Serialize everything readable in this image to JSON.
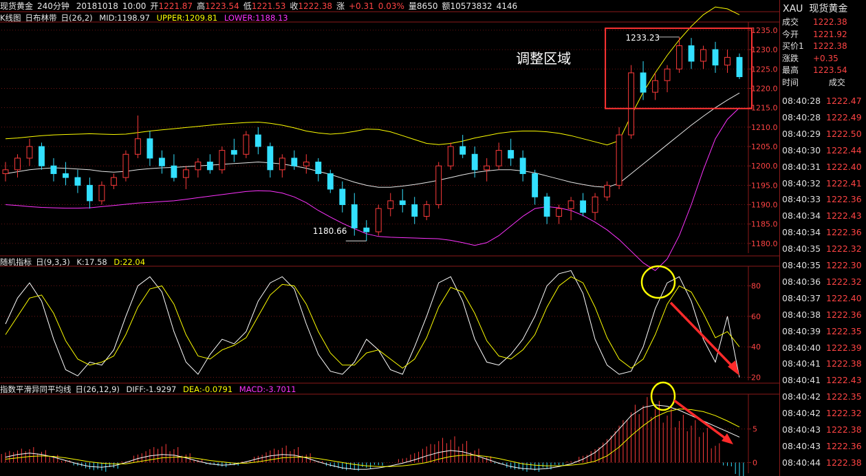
{
  "header": {
    "symbol": "现货黄金",
    "period": "240分钟",
    "date": "20181018",
    "time": "10:00",
    "open_label": "开",
    "open": "1221.87",
    "high_label": "高",
    "high": "1223.54",
    "low_label": "低",
    "low": "1221.53",
    "close_label": "收",
    "close": "1222.38",
    "change_label": "涨",
    "change": "+0.31",
    "change_pct": "0.03%",
    "volume_label": "量",
    "volume": "8650",
    "amount_label": "额",
    "amount": "10573832",
    "extra": "4146"
  },
  "main_panel": {
    "title": "K线图",
    "indicator": "日布林带",
    "params": "日(26,2)",
    "mid": "MID:1198.97",
    "upper": "UPPER:1209.81",
    "lower": "LOWER:1188.13",
    "annotation_text": "调整区域",
    "high_label": "1233.23",
    "low_label": "1180.66"
  },
  "kdj_panel": {
    "title": "随机指标",
    "params": "日(9,3,3)",
    "k": "K:17.58",
    "d": "D:22.04"
  },
  "macd_panel": {
    "title": "指数平滑异同平均线",
    "params": "日(26,12,9)",
    "diff": "DIFF:-1.9297",
    "dea": "DEA:-0.0791",
    "macd": "MACD:-3.7011"
  },
  "right_panel": {
    "code": "XAU",
    "name": "现货黄金",
    "quote": [
      {
        "label": "成交",
        "value": "1222.38"
      },
      {
        "label": "今开",
        "value": "1221.92"
      },
      {
        "label": "买价1",
        "value": "1222.38"
      },
      {
        "label": "涨跌",
        "value": "+0.35"
      },
      {
        "label": "最高",
        "value": "1223.54"
      }
    ],
    "col_time": "时间",
    "col_price": "成交",
    "ticks": [
      {
        "t": "08:40:28",
        "p": "1222.47"
      },
      {
        "t": "08:40:28",
        "p": "1222.49"
      },
      {
        "t": "08:40:29",
        "p": "1222.50"
      },
      {
        "t": "08:40:30",
        "p": "1222.44"
      },
      {
        "t": "08:40:31",
        "p": "1222.40"
      },
      {
        "t": "08:40:32",
        "p": "1222.41"
      },
      {
        "t": "08:40:33",
        "p": "1222.36"
      },
      {
        "t": "08:40:34",
        "p": "1222.43"
      },
      {
        "t": "08:40:34",
        "p": "1222.36"
      },
      {
        "t": "08:40:35",
        "p": "1222.32"
      },
      {
        "t": "08:40:35",
        "p": "1222.30"
      },
      {
        "t": "08:40:36",
        "p": "1222.32"
      },
      {
        "t": "08:40:37",
        "p": "1222.40"
      },
      {
        "t": "08:40:38",
        "p": "1222.36"
      },
      {
        "t": "08:40:39",
        "p": "1222.35"
      },
      {
        "t": "08:40:40",
        "p": "1222.39"
      },
      {
        "t": "08:40:41",
        "p": "1222.38"
      },
      {
        "t": "08:40:41",
        "p": "1222.43"
      },
      {
        "t": "08:40:42",
        "p": "1222.35"
      },
      {
        "t": "08:40:42",
        "p": "1222.32"
      },
      {
        "t": "08:40:43",
        "p": "1222.38"
      },
      {
        "t": "08:40:43",
        "p": "1222.36"
      },
      {
        "t": "08:40:44",
        "p": "1222.38"
      }
    ]
  },
  "colors": {
    "up": "#ff3b3b",
    "down": "#33e0ff",
    "mid": "#e8e8e8",
    "upper": "#ffff00",
    "lower": "#ff33ff",
    "grid": "#8b1a1a",
    "annotation": "#ff3333",
    "circle": "#ffff00"
  },
  "chart_data": [
    {
      "type": "line",
      "name": "candlestick-bollinger",
      "y_ticks": [
        1180.0,
        1185.0,
        1190.0,
        1195.0,
        1200.0,
        1205.0,
        1210.0,
        1215.0,
        1220.0,
        1225.0,
        1230.0,
        1235.0
      ],
      "ylim": [
        1177.5,
        1238.0
      ],
      "candles": [
        [
          1198,
          1201,
          1196,
          1199
        ],
        [
          1199,
          1203,
          1197,
          1202
        ],
        [
          1202,
          1207,
          1200,
          1205
        ],
        [
          1205,
          1206,
          1199,
          1200
        ],
        [
          1200,
          1202,
          1196,
          1198
        ],
        [
          1198,
          1201,
          1195,
          1197
        ],
        [
          1197,
          1199,
          1193,
          1195
        ],
        [
          1195,
          1197,
          1189,
          1191
        ],
        [
          1191,
          1196,
          1190,
          1195
        ],
        [
          1195,
          1198,
          1194,
          1197
        ],
        [
          1197,
          1204,
          1196,
          1203
        ],
        [
          1203,
          1213,
          1202,
          1207
        ],
        [
          1207,
          1209,
          1200,
          1202
        ],
        [
          1202,
          1204,
          1198,
          1200
        ],
        [
          1200,
          1203,
          1196,
          1197
        ],
        [
          1197,
          1200,
          1194,
          1199
        ],
        [
          1199,
          1202,
          1197,
          1201
        ],
        [
          1201,
          1203,
          1198,
          1199
        ],
        [
          1199,
          1205,
          1198,
          1204
        ],
        [
          1204,
          1207,
          1201,
          1203
        ],
        [
          1203,
          1209,
          1202,
          1208
        ],
        [
          1208,
          1210,
          1203,
          1205
        ],
        [
          1205,
          1206,
          1197,
          1199
        ],
        [
          1199,
          1203,
          1197,
          1202
        ],
        [
          1202,
          1204,
          1199,
          1200
        ],
        [
          1200,
          1203,
          1198,
          1201
        ],
        [
          1201,
          1202,
          1196,
          1198
        ],
        [
          1198,
          1199,
          1193,
          1194
        ],
        [
          1194,
          1196,
          1188,
          1190
        ],
        [
          1190,
          1193,
          1182,
          1184
        ],
        [
          1184,
          1186,
          1180.66,
          1183
        ],
        [
          1183,
          1190,
          1182,
          1189
        ],
        [
          1189,
          1193,
          1187,
          1191
        ],
        [
          1191,
          1194,
          1188,
          1190
        ],
        [
          1190,
          1192,
          1185,
          1187
        ],
        [
          1187,
          1191,
          1186,
          1190
        ],
        [
          1190,
          1201,
          1189,
          1200
        ],
        [
          1200,
          1206,
          1199,
          1205
        ],
        [
          1205,
          1208,
          1202,
          1203
        ],
        [
          1203,
          1205,
          1197,
          1199
        ],
        [
          1199,
          1202,
          1196,
          1200
        ],
        [
          1200,
          1206,
          1199,
          1204
        ],
        [
          1204,
          1207,
          1200,
          1202
        ],
        [
          1202,
          1204,
          1196,
          1198
        ],
        [
          1198,
          1199,
          1190,
          1192
        ],
        [
          1192,
          1193,
          1185,
          1187
        ],
        [
          1187,
          1190,
          1185,
          1189
        ],
        [
          1189,
          1192,
          1186,
          1191
        ],
        [
          1191,
          1193,
          1187,
          1188
        ],
        [
          1188,
          1193,
          1186,
          1192
        ],
        [
          1192,
          1196,
          1191,
          1195
        ],
        [
          1195,
          1210,
          1194,
          1208
        ],
        [
          1208,
          1226,
          1207,
          1224
        ],
        [
          1224,
          1227,
          1217,
          1219
        ],
        [
          1219,
          1224,
          1217,
          1222
        ],
        [
          1222,
          1226,
          1219,
          1225
        ],
        [
          1225,
          1233.23,
          1224,
          1231
        ],
        [
          1231,
          1233,
          1225,
          1227
        ],
        [
          1227,
          1231,
          1225,
          1230
        ],
        [
          1230,
          1232,
          1224,
          1226
        ],
        [
          1226,
          1230,
          1224,
          1228
        ],
        [
          1228,
          1229,
          1222.38,
          1223
        ]
      ],
      "mid": [
        1198,
        1198.5,
        1199,
        1199.3,
        1199.5,
        1199.4,
        1199.2,
        1199,
        1198.6,
        1198.4,
        1198.6,
        1199,
        1199.3,
        1199.5,
        1199.6,
        1199.8,
        1200,
        1200.2,
        1200.4,
        1200.6,
        1200.8,
        1201,
        1200.8,
        1200.5,
        1200,
        1199.4,
        1198.6,
        1197.8,
        1196.8,
        1195.8,
        1195,
        1194.5,
        1194.5,
        1194.8,
        1195.2,
        1195.7,
        1196.3,
        1197,
        1197.7,
        1198.3,
        1198.7,
        1199,
        1199,
        1198.7,
        1198.2,
        1197.4,
        1196.6,
        1195.8,
        1195.2,
        1194.7,
        1194.5,
        1195.5,
        1198,
        1200.5,
        1203,
        1205.5,
        1208,
        1210.5,
        1212.8,
        1215,
        1217,
        1218.8
      ],
      "upper": [
        1207,
        1207.2,
        1207.5,
        1207.8,
        1208,
        1208.1,
        1208.2,
        1208.3,
        1208.2,
        1208.1,
        1208.2,
        1208.6,
        1209,
        1209.3,
        1209.6,
        1209.9,
        1210.2,
        1210.5,
        1210.8,
        1211,
        1211.2,
        1211.3,
        1211,
        1210.5,
        1209.8,
        1209,
        1208.5,
        1208.2,
        1208.4,
        1208.9,
        1209.5,
        1209.4,
        1208.8,
        1207.8,
        1206.8,
        1205.8,
        1205.5,
        1205.8,
        1206.4,
        1207.2,
        1207.8,
        1208.4,
        1208.8,
        1209,
        1209,
        1208.8,
        1208.4,
        1207.8,
        1207,
        1206.2,
        1205.4,
        1206.5,
        1213,
        1219,
        1224,
        1228.5,
        1232.5,
        1236,
        1239,
        1241,
        1240.5,
        1239
      ],
      "lower": [
        1190,
        1189.8,
        1189.5,
        1189.3,
        1189.2,
        1189.1,
        1189.1,
        1189.2,
        1189.5,
        1189.8,
        1190.1,
        1190.4,
        1190.6,
        1190.8,
        1191,
        1191.4,
        1191.8,
        1192.2,
        1192.6,
        1193,
        1193.4,
        1193.6,
        1193.5,
        1193,
        1192,
        1190.5,
        1188.5,
        1186.8,
        1185.2,
        1183.8,
        1182.5,
        1181.8,
        1181.6,
        1181.5,
        1181.4,
        1181.3,
        1181.2,
        1180.8,
        1180.2,
        1179.5,
        1180.2,
        1182,
        1184.5,
        1187,
        1189,
        1189.5,
        1189.2,
        1188.5,
        1187.2,
        1185.5,
        1183.5,
        1181,
        1178,
        1175,
        1173,
        1176,
        1182,
        1190,
        1199,
        1207,
        1212,
        1215
      ],
      "annotations": [
        "调整区域",
        "1233.23",
        "1180.66"
      ]
    },
    {
      "type": "line",
      "name": "kdj",
      "y_ticks": [
        20,
        40,
        60,
        80
      ],
      "ylim": [
        18,
        92
      ],
      "series": [
        {
          "name": "K",
          "values": [
            55,
            72,
            82,
            70,
            45,
            25,
            21,
            30,
            28,
            38,
            60,
            80,
            86,
            76,
            50,
            30,
            22,
            35,
            45,
            42,
            50,
            70,
            82,
            86,
            78,
            55,
            35,
            24,
            22,
            30,
            45,
            38,
            25,
            22,
            40,
            60,
            82,
            86,
            70,
            45,
            30,
            28,
            35,
            45,
            60,
            80,
            88,
            90,
            75,
            45,
            28,
            22,
            24,
            40,
            65,
            82,
            86,
            70,
            45,
            30,
            60,
            20
          ]
        },
        {
          "name": "D",
          "values": [
            48,
            60,
            72,
            74,
            62,
            44,
            32,
            28,
            30,
            34,
            48,
            66,
            78,
            80,
            68,
            48,
            34,
            32,
            38,
            41,
            46,
            60,
            74,
            81,
            80,
            68,
            50,
            36,
            28,
            28,
            36,
            38,
            32,
            26,
            32,
            46,
            66,
            79,
            76,
            62,
            44,
            34,
            32,
            38,
            48,
            66,
            80,
            86,
            82,
            66,
            46,
            32,
            26,
            32,
            48,
            68,
            80,
            76,
            62,
            46,
            50,
            40
          ]
        }
      ]
    },
    {
      "type": "bar",
      "name": "macd",
      "y_ticks": [
        0,
        5
      ],
      "ylim": [
        -1.6,
        10
      ],
      "series": [
        {
          "name": "MACD",
          "values": [
            1.5,
            1.8,
            2,
            1.6,
            1,
            0.3,
            -0.5,
            -1,
            -1.2,
            -0.8,
            0.2,
            1.2,
            2,
            2.4,
            2,
            1.2,
            0.4,
            -0.3,
            -0.6,
            -0.4,
            0.2,
            1,
            1.8,
            2.2,
            2,
            1.2,
            0.2,
            -0.6,
            -1,
            -1.1,
            -0.8,
            -0.4,
            0,
            0.6,
            1.4,
            2.4,
            3.2,
            3.4,
            2.8,
            1.8,
            0.8,
            -0.2,
            -0.9,
            -1.2,
            -1.2,
            -0.9,
            -0.4,
            0.2,
            1,
            2,
            3.5,
            5.5,
            7.5,
            8.5,
            8,
            7,
            6.2,
            5.5,
            4.5,
            2.5,
            -0.5,
            -2
          ]
        },
        {
          "name": "DIFF",
          "values": [
            0.8,
            1.2,
            1.4,
            1.2,
            0.8,
            0.3,
            -0.2,
            -0.6,
            -0.7,
            -0.5,
            0,
            0.6,
            1,
            1.2,
            1.1,
            0.7,
            0.2,
            -0.2,
            -0.4,
            -0.3,
            0.1,
            0.6,
            1,
            1.2,
            1.1,
            0.7,
            0.1,
            -0.4,
            -0.8,
            -1,
            -1,
            -0.8,
            -0.5,
            -0.1,
            0.4,
            1,
            1.5,
            1.8,
            1.6,
            1.1,
            0.5,
            -0.1,
            -0.6,
            -0.9,
            -1,
            -0.9,
            -0.6,
            -0.2,
            0.5,
            1.5,
            3,
            5,
            7,
            8.2,
            8.6,
            8.4,
            7.8,
            7,
            6.2,
            5.4,
            4.6,
            3.8
          ]
        },
        {
          "name": "DEA",
          "values": [
            0.5,
            0.7,
            0.9,
            1,
            0.9,
            0.7,
            0.4,
            0.1,
            -0.1,
            -0.2,
            -0.2,
            0.1,
            0.4,
            0.7,
            0.8,
            0.8,
            0.6,
            0.3,
            0.1,
            -0.1,
            -0.1,
            0.1,
            0.4,
            0.7,
            0.8,
            0.8,
            0.6,
            0.3,
            0,
            -0.3,
            -0.5,
            -0.6,
            -0.6,
            -0.5,
            -0.3,
            0,
            0.5,
            0.9,
            1.1,
            1.1,
            0.9,
            0.6,
            0.2,
            -0.2,
            -0.4,
            -0.5,
            -0.5,
            -0.4,
            -0.2,
            0.2,
            1,
            2.3,
            4,
            5.5,
            6.8,
            7.6,
            8,
            7.9,
            7.6,
            7,
            6.2,
            5.3
          ]
        }
      ]
    }
  ]
}
